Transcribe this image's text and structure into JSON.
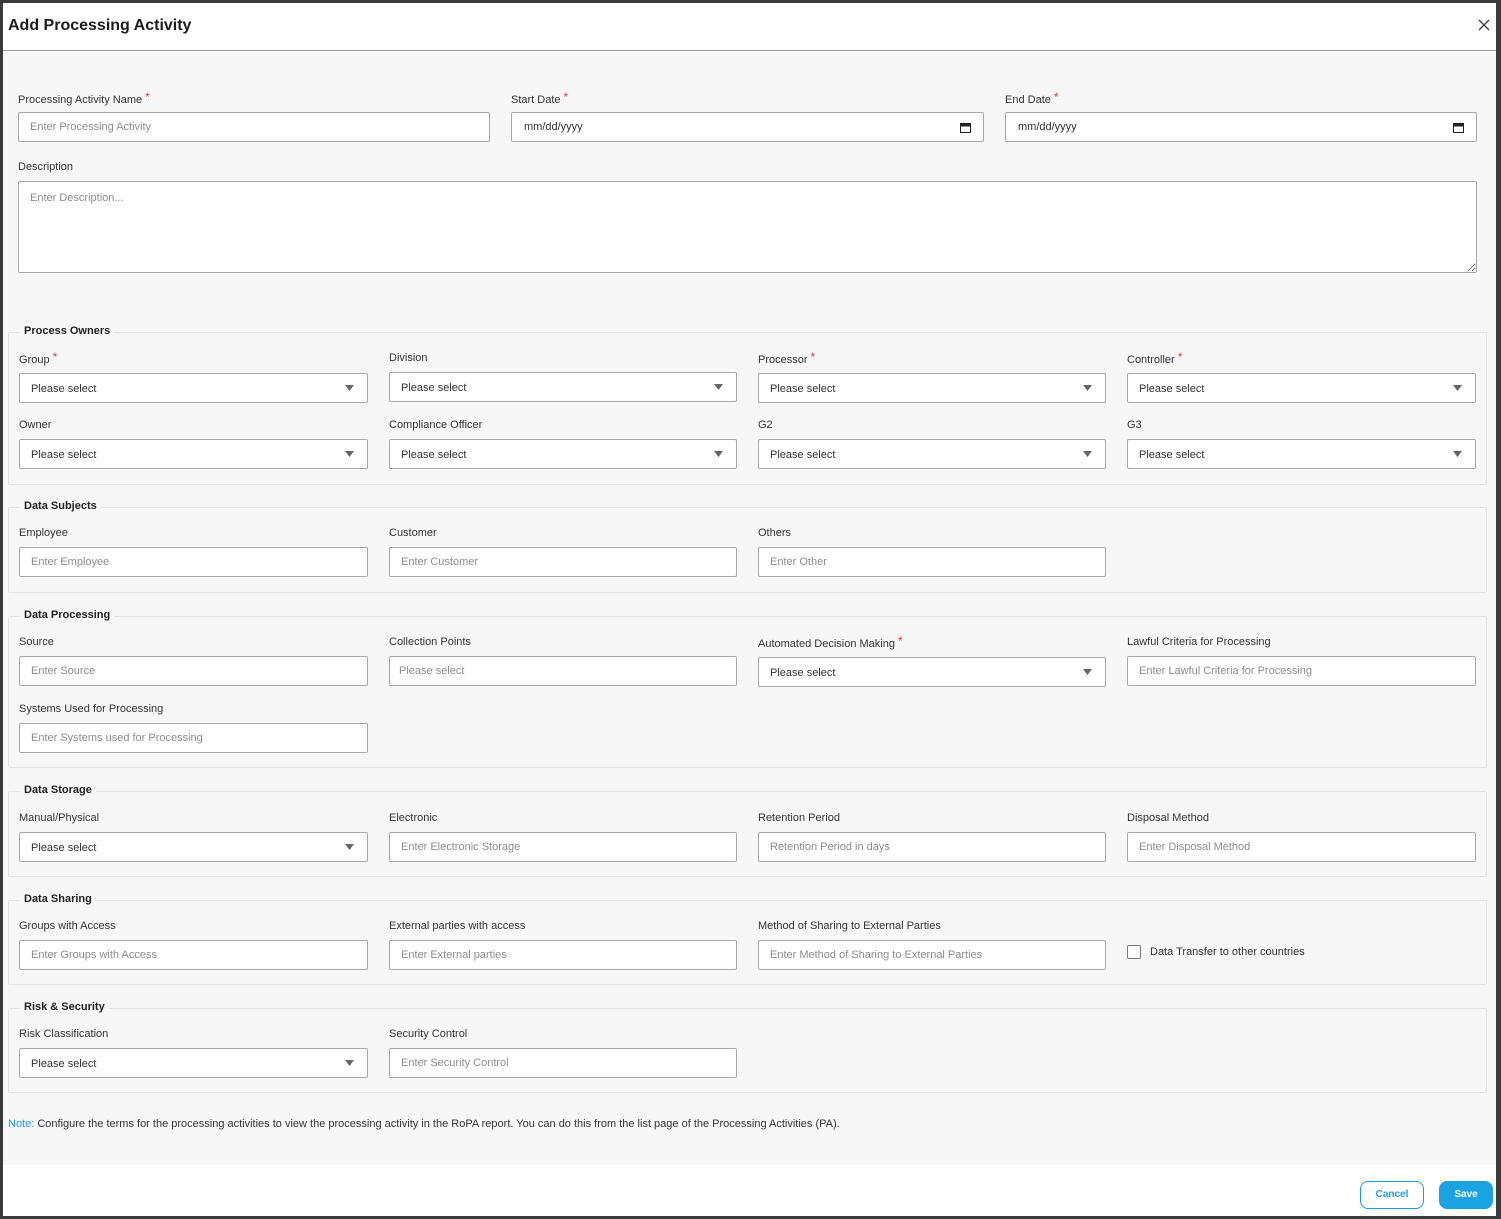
{
  "modal": {
    "title": "Add Processing Activity"
  },
  "top": {
    "pa_name": {
      "label": "Processing Activity Name",
      "placeholder": "Enter Processing Activity"
    },
    "start_date": {
      "label": "Start Date",
      "value": "mm/dd/yyyy"
    },
    "end_date": {
      "label": "End Date",
      "value": "mm/dd/yyyy"
    },
    "description": {
      "label": "Description",
      "placeholder": "Enter Description..."
    }
  },
  "required_mark": "*",
  "process_owners": {
    "legend": "Process Owners",
    "group": {
      "label": "Group",
      "value": "Please select"
    },
    "division": {
      "label": "Division",
      "value": "Please select"
    },
    "processor": {
      "label": "Processor",
      "value": "Please select"
    },
    "controller": {
      "label": "Controller",
      "value": "Please select"
    },
    "owner": {
      "label": "Owner",
      "value": "Please select"
    },
    "compliance_officer": {
      "label": "Compliance Officer",
      "value": "Please select"
    },
    "g2": {
      "label": "G2",
      "value": "Please select"
    },
    "g3": {
      "label": "G3",
      "value": "Please select"
    }
  },
  "data_subjects": {
    "legend": "Data Subjects",
    "employee": {
      "label": "Employee",
      "placeholder": "Enter Employee"
    },
    "customer": {
      "label": "Customer",
      "placeholder": "Enter Customer"
    },
    "others": {
      "label": "Others",
      "placeholder": "Enter Other"
    }
  },
  "data_processing": {
    "legend": "Data Processing",
    "source": {
      "label": "Source",
      "placeholder": "Enter Source"
    },
    "collection_points": {
      "label": "Collection Points",
      "placeholder": "Please select"
    },
    "automated_decision": {
      "label": "Automated Decision Making",
      "value": "Please select"
    },
    "lawful_criteria": {
      "label": "Lawful Criteria for Processing",
      "placeholder": "Enter Lawful Criteria for Processing"
    },
    "systems_used": {
      "label": "Systems Used for Processing",
      "placeholder": "Enter Systems used for Processing"
    }
  },
  "data_storage": {
    "legend": "Data Storage",
    "manual_physical": {
      "label": "Manual/Physical",
      "value": "Please select"
    },
    "electronic": {
      "label": "Electronic",
      "placeholder": "Enter Electronic Storage"
    },
    "retention_period": {
      "label": "Retention Period",
      "placeholder": "Retention Period in days"
    },
    "disposal_method": {
      "label": "Disposal Method",
      "placeholder": "Enter Disposal Method"
    }
  },
  "data_sharing": {
    "legend": "Data Sharing",
    "groups_with_access": {
      "label": "Groups with Access",
      "placeholder": "Enter Groups with Access"
    },
    "external_parties": {
      "label": "External parties with access",
      "placeholder": "Enter External parties"
    },
    "method_of_sharing": {
      "label": "Method of Sharing to External Parties",
      "placeholder": "Enter Method of Sharing to External Parties"
    },
    "data_transfer": {
      "label": "Data Transfer to other countries",
      "checked": false
    }
  },
  "risk_security": {
    "legend": "Risk & Security",
    "risk_classification": {
      "label": "Risk Classification",
      "value": "Please select"
    },
    "security_control": {
      "label": "Security Control",
      "placeholder": "Enter Security Control"
    }
  },
  "note": {
    "key": "Note:",
    "text": " Configure the terms for the processing activities to view the processing activity in the RoPA report. You can do this from the list page of the Processing Activities (PA)."
  },
  "footer": {
    "cancel_label": "Cancel",
    "save_label": "Save"
  },
  "icons": {
    "close": "close-icon",
    "calendar": "calendar-icon",
    "caret": "caret-down-icon"
  },
  "colors": {
    "accent": "#1aa3e0",
    "required": "#e53935",
    "note": "#2196f3"
  }
}
